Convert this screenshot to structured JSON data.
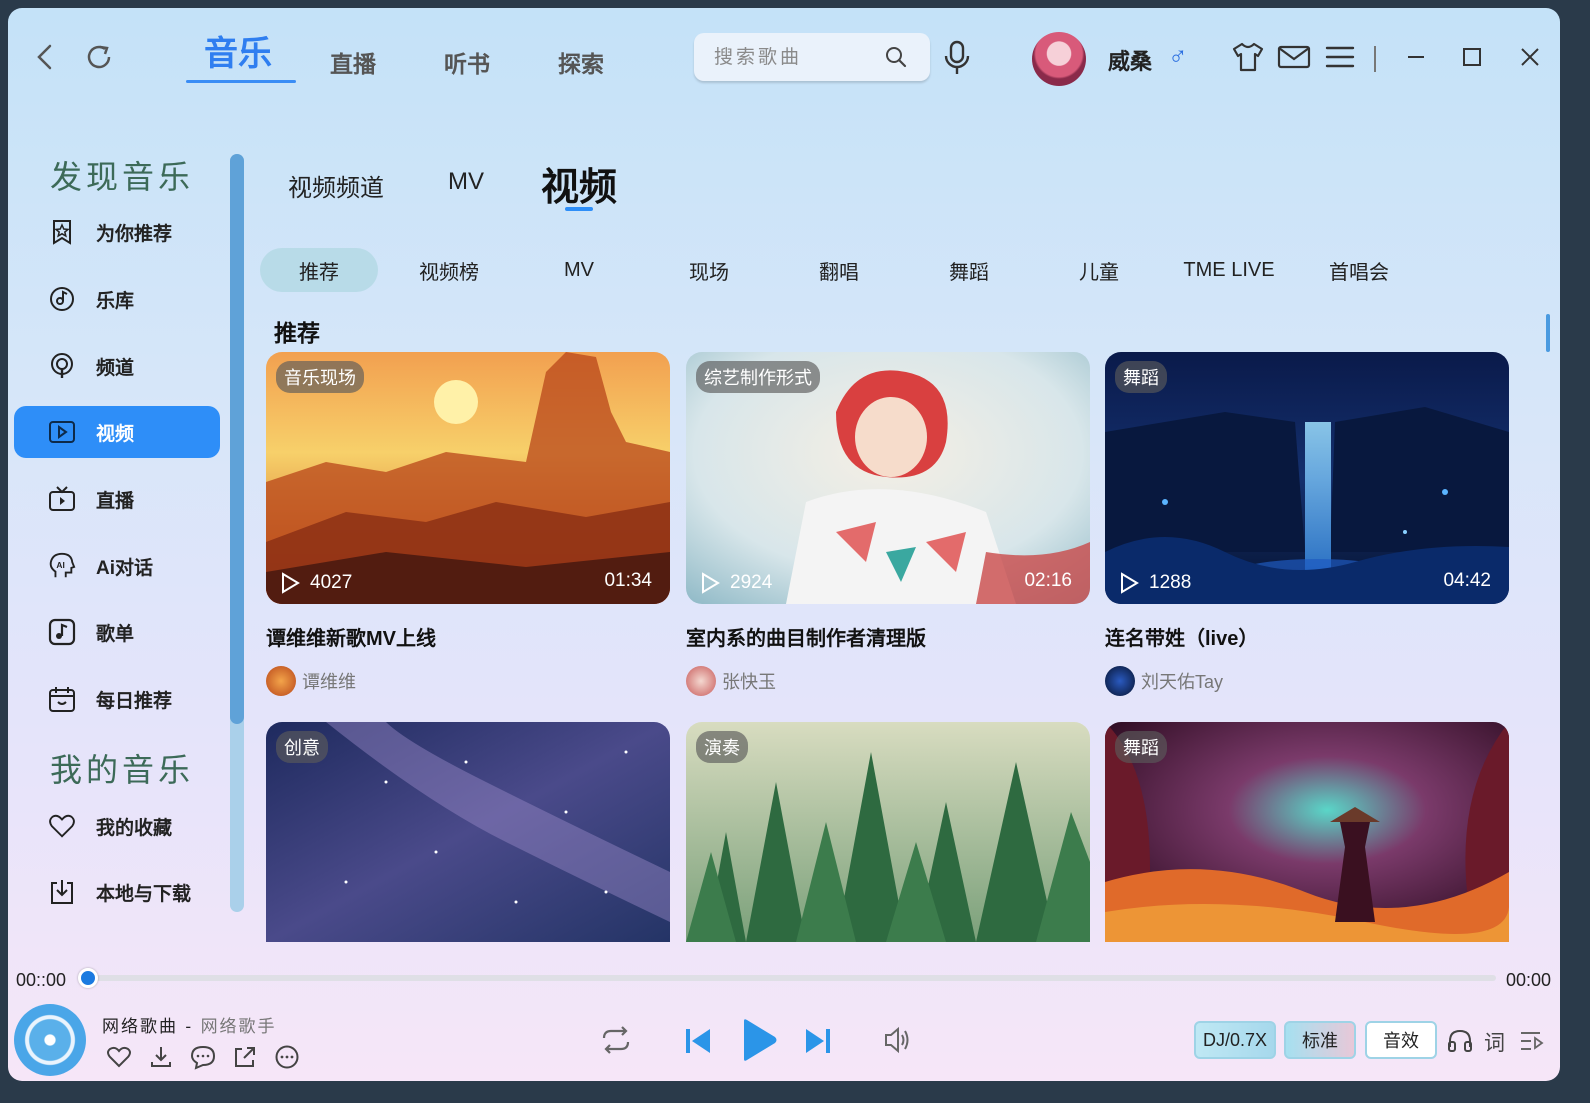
{
  "topbar": {
    "tabs": [
      {
        "label": "音乐",
        "active": true
      },
      {
        "label": "直播"
      },
      {
        "label": "听书"
      },
      {
        "label": "探索"
      }
    ],
    "search_placeholder": "搜索歌曲",
    "username": "威桑",
    "gender_symbol": "♂"
  },
  "sidebar": {
    "discover_heading": "发现音乐",
    "discover_items": [
      {
        "label": "为你推荐",
        "icon": "star-bookmark-icon"
      },
      {
        "label": "乐库",
        "icon": "music-disc-icon"
      },
      {
        "label": "频道",
        "icon": "podcast-icon"
      },
      {
        "label": "视频",
        "icon": "video-play-icon",
        "active": true
      },
      {
        "label": "直播",
        "icon": "tv-icon"
      },
      {
        "label": "Ai对话",
        "icon": "ai-head-icon"
      },
      {
        "label": "歌单",
        "icon": "playlist-icon"
      },
      {
        "label": "每日推荐",
        "icon": "calendar-icon"
      }
    ],
    "mine_heading": "我的音乐",
    "mine_items": [
      {
        "label": "我的收藏",
        "icon": "heart-icon"
      },
      {
        "label": "本地与下载",
        "icon": "download-icon"
      }
    ]
  },
  "content": {
    "sub_tabs": [
      {
        "label": "视频频道"
      },
      {
        "label": "MV"
      },
      {
        "label": "视频",
        "active": true
      }
    ],
    "chips": [
      "推荐",
      "视频榜",
      "MV",
      "现场",
      "翻唱",
      "舞蹈",
      "儿童",
      "TME LIVE",
      "首唱会"
    ],
    "active_chip": "推荐",
    "section_title": "推荐",
    "cards": [
      {
        "tag": "音乐现场",
        "plays": "4027",
        "duration": "01:34",
        "title": "谭维维新歌MV上线",
        "author": "谭维维",
        "scene": "desert-sunset"
      },
      {
        "tag": "综艺制作形式",
        "plays": "2924",
        "duration": "02:16",
        "title": "室内系的曲目制作者清理版",
        "author": "张快玉",
        "scene": "anime-girl"
      },
      {
        "tag": "舞蹈",
        "plays": "1288",
        "duration": "04:42",
        "title": "连名带姓（live）",
        "author": "刘天佑Tay",
        "scene": "night-waterfall"
      },
      {
        "tag": "创意",
        "scene": "starry-sky"
      },
      {
        "tag": "演奏",
        "scene": "misty-forest"
      },
      {
        "tag": "舞蹈",
        "scene": "red-forest-samurai"
      }
    ]
  },
  "player": {
    "current_time": "00::00",
    "total_time": "00:00",
    "progress": 0,
    "song": "网络歌曲",
    "separator": " - ",
    "artist": "网络歌手",
    "speed_label": "DJ/0.7X",
    "quality_label": "标准",
    "effect_label": "音效",
    "lyrics_label": "词"
  },
  "colors": {
    "accent": "#2e8ef8",
    "active_tab": "#2f7ef0"
  }
}
